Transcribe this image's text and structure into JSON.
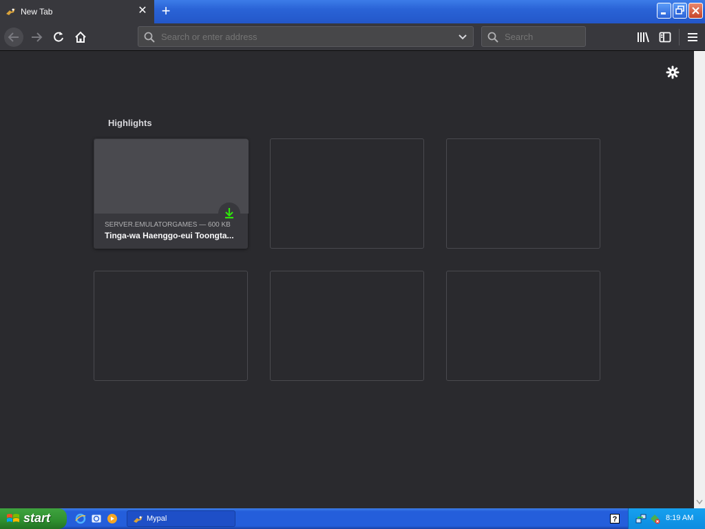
{
  "browser": {
    "tab": {
      "title": "New Tab",
      "close_symbol": "✕"
    },
    "new_tab_symbol": "+",
    "window_controls": {
      "minimize": "-",
      "maximize": "❐",
      "close": "✕"
    },
    "address_bar": {
      "placeholder": "Search or enter address",
      "value": ""
    },
    "search_bar": {
      "placeholder": "Search",
      "value": ""
    }
  },
  "newtab_page": {
    "highlights_title": "Highlights",
    "cards": [
      {
        "host": "SERVER.EMULATORGAMES — 600 KB",
        "title": "Tinga-wa Haenggo-eui Toongta..."
      }
    ]
  },
  "taskbar": {
    "start_label": "start",
    "task_button_label": "Mypal",
    "help_label": "?",
    "clock": "8:19 AM"
  },
  "colors": {
    "content_bg": "#2a2a2e",
    "toolbar_bg": "#38383d",
    "download_green": "#30e60b",
    "xp_blue": "#245edb",
    "start_green": "#3fa33f"
  }
}
